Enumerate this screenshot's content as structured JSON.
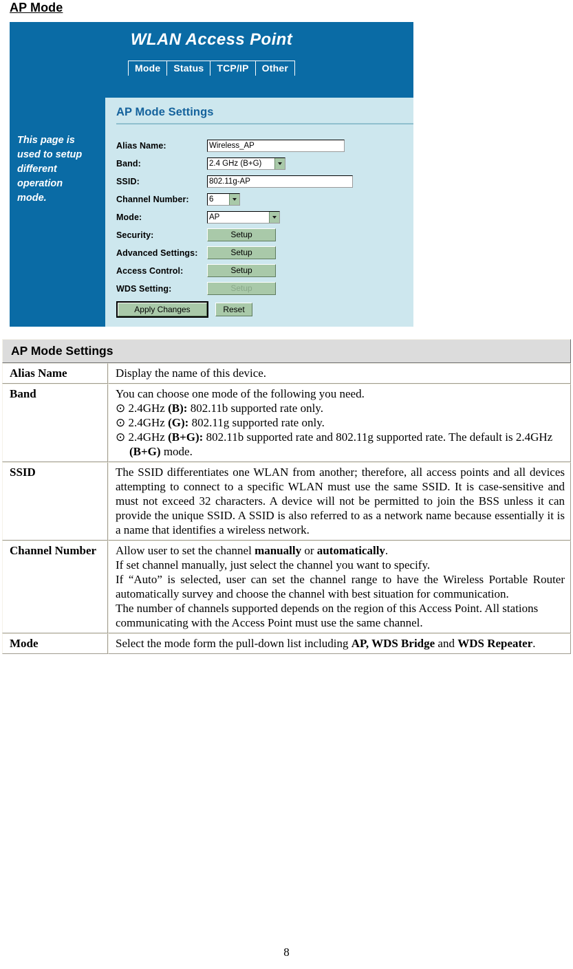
{
  "page": {
    "heading": "AP Mode",
    "page_number": "8"
  },
  "router_ui": {
    "title": "WLAN Access Point",
    "tabs": [
      {
        "label": "Mode"
      },
      {
        "label": "Status"
      },
      {
        "label": "TCP/IP"
      },
      {
        "label": "Other"
      }
    ],
    "sidebar": {
      "help_text": "This page is used to setup different operation mode."
    },
    "panel": {
      "title": "AP Mode Settings",
      "fields": {
        "alias_name": {
          "label": "Alias Name:",
          "value": "Wireless_AP"
        },
        "band": {
          "label": "Band:",
          "value": "2.4 GHz (B+G)"
        },
        "ssid": {
          "label": "SSID:",
          "value": "802.11g-AP"
        },
        "channel_number": {
          "label": "Channel Number:",
          "value": "6"
        },
        "mode": {
          "label": "Mode:",
          "value": "AP"
        },
        "security": {
          "label": "Security:",
          "button": "Setup"
        },
        "advanced_settings": {
          "label": "Advanced Settings:",
          "button": "Setup"
        },
        "access_control": {
          "label": "Access Control:",
          "button": "Setup"
        },
        "wds_setting": {
          "label": "WDS Setting:",
          "button": "Setup"
        }
      },
      "actions": {
        "apply": "Apply Changes",
        "reset": "Reset"
      }
    },
    "colors": {
      "header_blue": "#0a6ba5",
      "panel_background": "#cde7ee",
      "panel_title": "#14629c",
      "button_green": "#a9c9a9"
    }
  },
  "doc_table": {
    "header": "AP Mode Settings",
    "rows": {
      "alias_name": {
        "key": "Alias Name",
        "text": "Display the name of this device."
      },
      "band": {
        "key": "Band",
        "intro": "You can choose one mode of the following you need.",
        "bullet_icon": "radio-selected-icon",
        "options": [
          {
            "bullet": "⊙",
            "freq": "2.4GHz ",
            "label": "(B):",
            "desc": " 802.11b supported rate only."
          },
          {
            "bullet": "⊙",
            "freq": "2.4GHz ",
            "label": "(G):",
            "desc": " 802.11g supported rate only."
          },
          {
            "bullet": "⊙",
            "freq": "2.4GHz ",
            "label": "(B+G):",
            "desc": " 802.11b supported rate and 802.11g supported rate. The default is 2.4GHz ",
            "desc_bold_tail": "(B+G)",
            "desc_tail": " mode."
          }
        ]
      },
      "ssid": {
        "key": "SSID",
        "text": "The SSID differentiates one WLAN from another; therefore, all access points and all devices attempting to connect to a specific WLAN must use the same SSID. It is case-sensitive and must not exceed 32 characters. A device will not be permitted to join the BSS unless it can provide the unique SSID. A SSID is also referred to as a network name because essentially it is a name that identifies a wireless network."
      },
      "channel_number": {
        "key": "Channel Number",
        "line1_a": "Allow user to set the channel ",
        "line1_b": "manually",
        "line1_c": " or ",
        "line1_d": "automatically",
        "line1_e": ".",
        "line2": "If set channel manually, just select the channel you want to specify.",
        "line3": "If “Auto” is selected, user can set the channel range to have the Wireless Portable Router automatically survey and choose the channel with best situation for communication.",
        "line4": "The number of channels supported depends on the region of this Access Point. All stations communicating with the Access Point must use the same channel."
      },
      "mode": {
        "key": "Mode",
        "text_a": "Select the mode form the pull-down list including ",
        "text_b": "AP, WDS Bridge",
        "text_c": " and ",
        "text_d": "WDS Repeater",
        "text_e": "."
      }
    }
  }
}
